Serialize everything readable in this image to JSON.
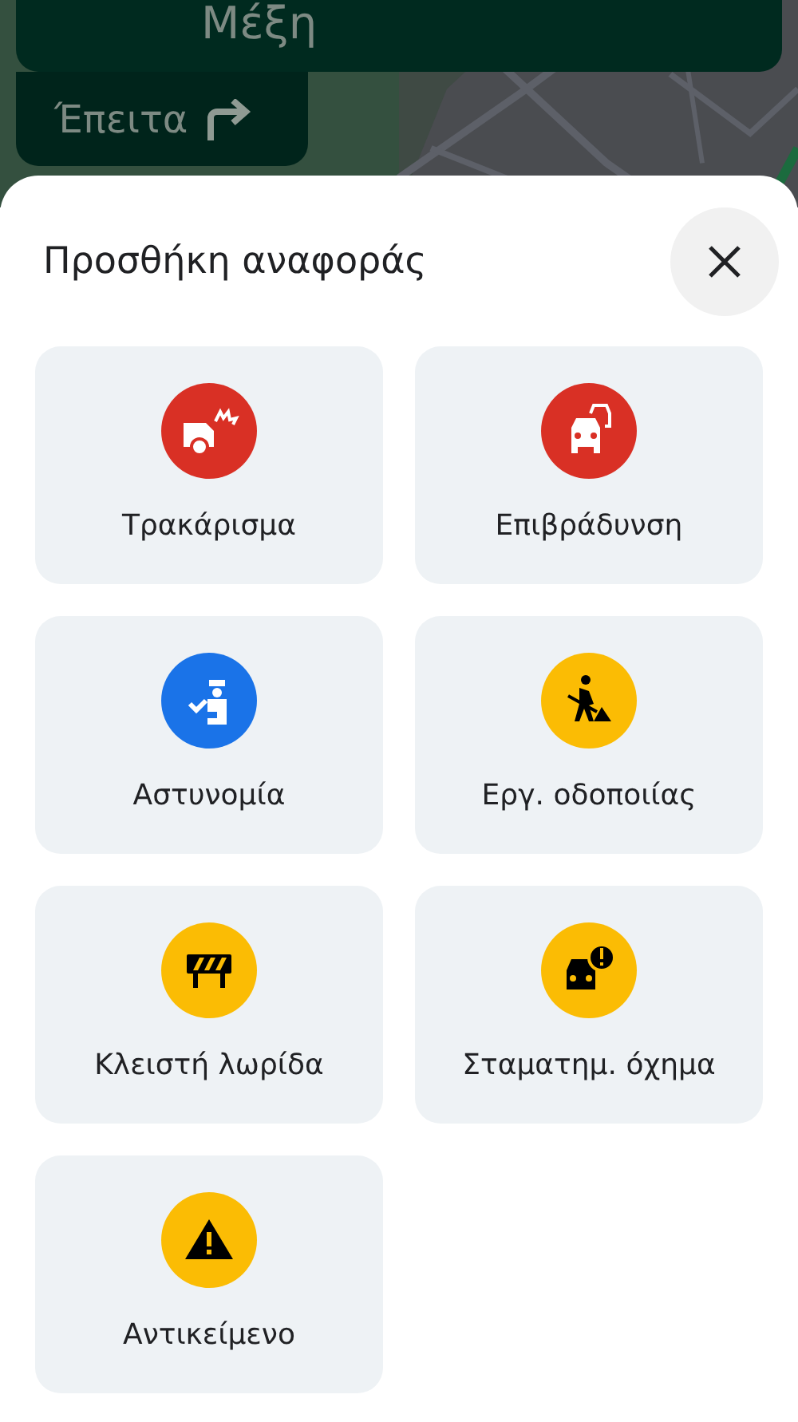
{
  "navigation": {
    "street": "Μέξη",
    "next_label": "Έπειτα"
  },
  "sheet": {
    "title": "Προσθήκη αναφοράς"
  },
  "reports": [
    {
      "label": "Τρακάρισμα",
      "kind": "crash",
      "color": "#d93025"
    },
    {
      "label": "Επιβράδυνση",
      "kind": "slowdown",
      "color": "#d93025"
    },
    {
      "label": "Αστυνομία",
      "kind": "police",
      "color": "#1a73e8"
    },
    {
      "label": "Εργ. οδοποιίας",
      "kind": "construction",
      "color": "#fbbc04"
    },
    {
      "label": "Κλειστή λωρίδα",
      "kind": "lane",
      "color": "#fbbc04"
    },
    {
      "label": "Σταματημ. όχημα",
      "kind": "stalled",
      "color": "#fbbc04"
    },
    {
      "label": "Αντικείμενο",
      "kind": "hazard",
      "color": "#fbbc04"
    }
  ]
}
